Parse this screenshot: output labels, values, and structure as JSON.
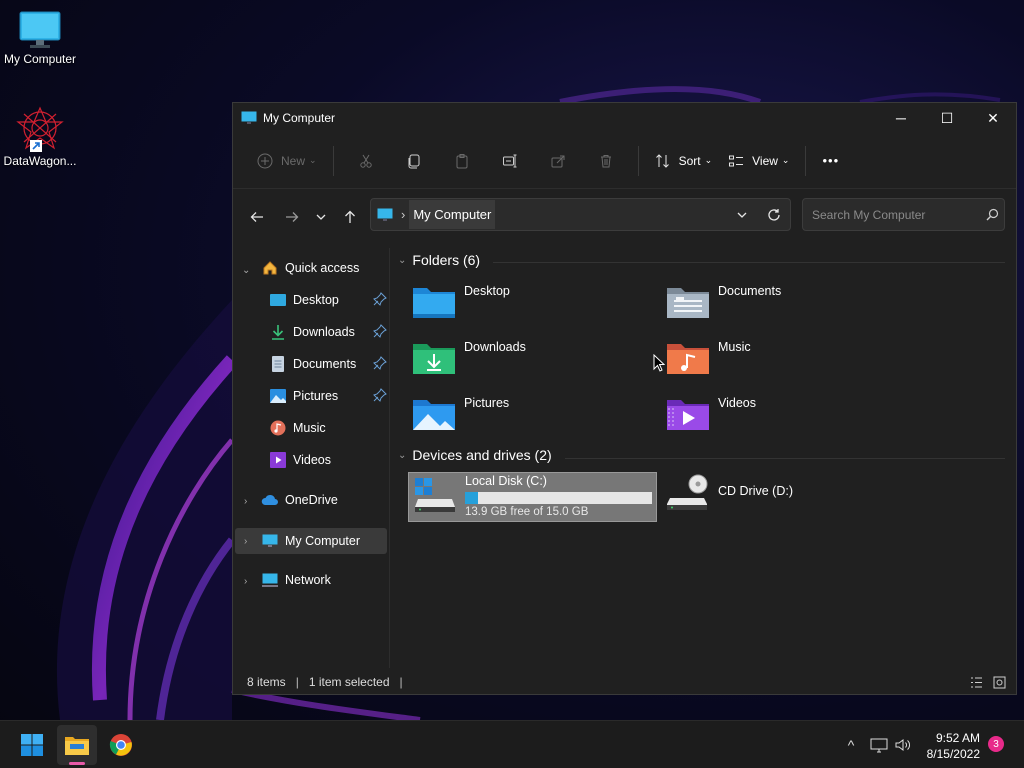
{
  "desktop": {
    "icons": [
      {
        "label": "My Computer",
        "icon": "monitor-icon"
      },
      {
        "label": "DataWagon...",
        "icon": "datawagon-app-icon"
      }
    ]
  },
  "window": {
    "title": "My Computer",
    "controls": {
      "minimize": "─",
      "maximize": "☐",
      "close": "✕"
    },
    "toolbar": {
      "new_label": "New",
      "sort_label": "Sort",
      "view_label": "View",
      "more_label": "•••"
    },
    "address": {
      "crumb": "My Computer",
      "separator": "›"
    },
    "search": {
      "placeholder": "Search My Computer"
    },
    "sidebar": {
      "quick_access": "Quick access",
      "items": [
        {
          "label": "Desktop",
          "pinned": true
        },
        {
          "label": "Downloads",
          "pinned": true
        },
        {
          "label": "Documents",
          "pinned": true
        },
        {
          "label": "Pictures",
          "pinned": true
        },
        {
          "label": "Music",
          "pinned": false
        },
        {
          "label": "Videos",
          "pinned": false
        }
      ],
      "onedrive": "OneDrive",
      "my_computer": "My Computer",
      "network": "Network"
    },
    "folders_header": "Folders (6)",
    "folders": [
      {
        "label": "Desktop",
        "icon": "desktop-folder-icon"
      },
      {
        "label": "Documents",
        "icon": "documents-folder-icon"
      },
      {
        "label": "Downloads",
        "icon": "downloads-folder-icon"
      },
      {
        "label": "Music",
        "icon": "music-folder-icon"
      },
      {
        "label": "Pictures",
        "icon": "pictures-folder-icon"
      },
      {
        "label": "Videos",
        "icon": "videos-folder-icon"
      }
    ],
    "devices_header": "Devices and drives (2)",
    "drives": [
      {
        "label": "Local Disk (C:)",
        "free_text": "13.9 GB free of 15.0 GB",
        "used_fraction": 0.07,
        "selected": true
      },
      {
        "label": "CD Drive (D:)"
      }
    ],
    "status": {
      "items": "8 items",
      "selected": "1 item selected",
      "sep": "|"
    }
  },
  "taskbar": {
    "time": "9:52 AM",
    "date": "8/15/2022",
    "notification_count": "3",
    "tray_up": "^"
  },
  "colors": {
    "accent": "#26a0da",
    "window_bg": "#202020",
    "taskbar_bg": "#1c1c1c",
    "selection": "#777777",
    "badge": "#e82a8a"
  }
}
